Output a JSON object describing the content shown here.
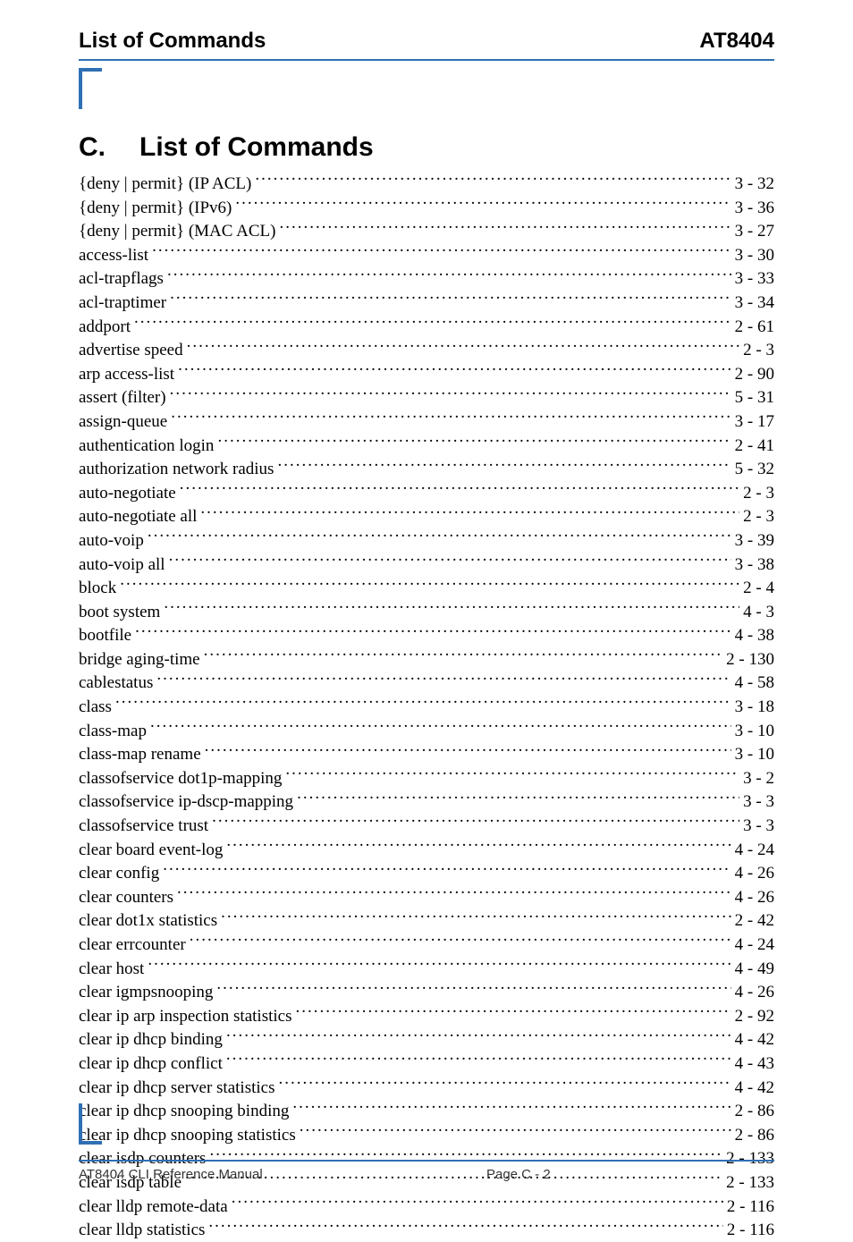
{
  "header": {
    "left": "List of Commands",
    "right": "AT8404"
  },
  "section": {
    "number": "C.",
    "title": "List of Commands"
  },
  "toc": [
    {
      "label": "{deny | permit} (IP ACL)",
      "page": "3 - 32"
    },
    {
      "label": "{deny | permit} (IPv6)",
      "page": "3 - 36"
    },
    {
      "label": "{deny | permit} (MAC ACL)",
      "page": "3 - 27"
    },
    {
      "label": "access-list",
      "page": "3 - 30"
    },
    {
      "label": "acl-trapflags",
      "page": "3 - 33"
    },
    {
      "label": "acl-traptimer",
      "page": "3 - 34"
    },
    {
      "label": "addport",
      "page": "2 - 61"
    },
    {
      "label": "advertise speed",
      "page": "2 - 3"
    },
    {
      "label": "arp access-list",
      "page": "2 - 90"
    },
    {
      "label": "assert (filter)",
      "page": "5 - 31"
    },
    {
      "label": "assign-queue",
      "page": "3 - 17"
    },
    {
      "label": "authentication login",
      "page": "2 - 41"
    },
    {
      "label": "authorization network radius",
      "page": "5 - 32"
    },
    {
      "label": "auto-negotiate",
      "page": "2 - 3"
    },
    {
      "label": "auto-negotiate all",
      "page": "2 - 3"
    },
    {
      "label": "auto-voip",
      "page": "3 - 39"
    },
    {
      "label": "auto-voip all",
      "page": "3 - 38"
    },
    {
      "label": "block",
      "page": "2 - 4"
    },
    {
      "label": "boot system",
      "page": "4 - 3"
    },
    {
      "label": "bootfile",
      "page": "4 - 38"
    },
    {
      "label": "bridge aging-time",
      "page": "2 - 130"
    },
    {
      "label": "cablestatus",
      "page": "4 - 58"
    },
    {
      "label": "class",
      "page": "3 - 18"
    },
    {
      "label": "class-map",
      "page": "3 - 10"
    },
    {
      "label": "class-map rename",
      "page": "3 - 10"
    },
    {
      "label": "classofservice dot1p-mapping",
      "page": "3 - 2"
    },
    {
      "label": "classofservice ip-dscp-mapping",
      "page": "3 - 3"
    },
    {
      "label": "classofservice trust",
      "page": "3 - 3"
    },
    {
      "label": "clear board event-log",
      "page": "4 - 24"
    },
    {
      "label": "clear config",
      "page": "4 - 26"
    },
    {
      "label": "clear counters",
      "page": "4 - 26"
    },
    {
      "label": "clear dot1x statistics",
      "page": "2 - 42"
    },
    {
      "label": "clear errcounter",
      "page": "4 - 24"
    },
    {
      "label": "clear host",
      "page": "4 - 49"
    },
    {
      "label": "clear igmpsnooping",
      "page": "4 - 26"
    },
    {
      "label": "clear ip arp inspection statistics",
      "page": "2 - 92"
    },
    {
      "label": "clear ip dhcp binding",
      "page": "4 - 42"
    },
    {
      "label": "clear ip dhcp conflict",
      "page": "4 - 43"
    },
    {
      "label": "clear ip dhcp server statistics",
      "page": "4 - 42"
    },
    {
      "label": "clear ip dhcp snooping binding",
      "page": "2 - 86"
    },
    {
      "label": "clear ip dhcp snooping statistics",
      "page": "2 - 86"
    },
    {
      "label": "clear isdp counters",
      "page": "2 - 133"
    },
    {
      "label": "clear isdp table",
      "page": "2 - 133"
    },
    {
      "label": "clear lldp remote-data",
      "page": "2 - 116"
    },
    {
      "label": "clear lldp statistics",
      "page": "2 - 116"
    }
  ],
  "footer": {
    "left": "AT8404 CLI Reference Manual",
    "center": "Page C - 2",
    "right": ""
  }
}
